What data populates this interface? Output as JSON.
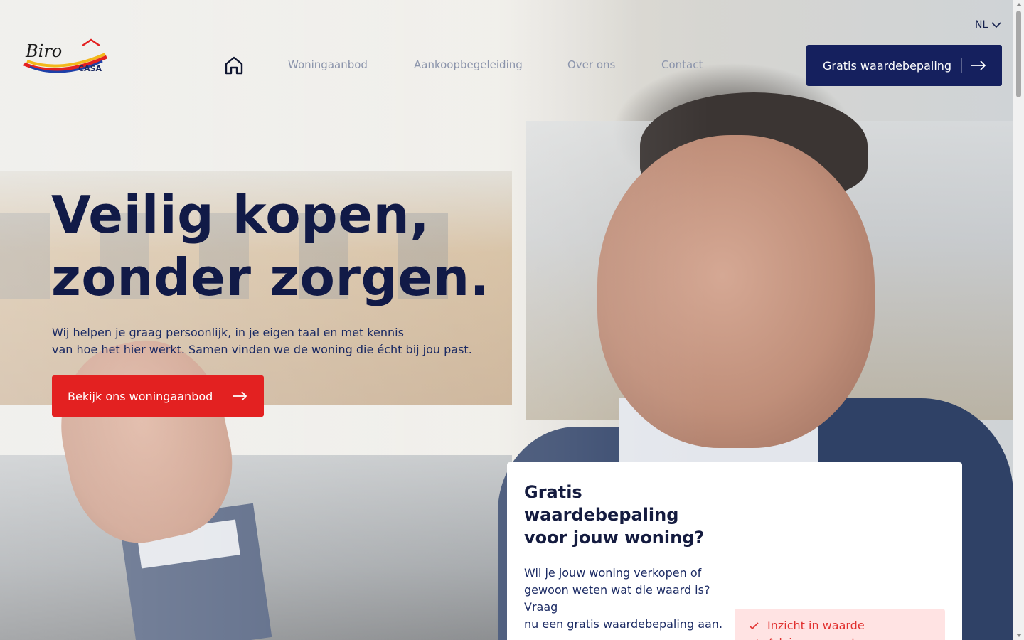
{
  "brand": {
    "logo_word": "Biro",
    "logo_sub": "CASA"
  },
  "header": {
    "language": "NL",
    "nav": [
      {
        "label": "Woningaanbod"
      },
      {
        "label": "Aankoopbegeleiding"
      },
      {
        "label": "Over ons"
      },
      {
        "label": "Contact"
      }
    ],
    "cta_label": "Gratis waardebepaling"
  },
  "hero": {
    "title_line1": "Veilig kopen,",
    "title_line2": "zonder zorgen.",
    "subtitle_line1": "Wij helpen je graag persoonlijk, in je eigen taal en met kennis",
    "subtitle_line2": "van hoe het hier werkt. Samen vinden we de woning die écht bij jou past.",
    "cta_label": "Bekijk ons woningaanbod"
  },
  "card": {
    "title_line1": "Gratis",
    "title_line2": "waardebepaling",
    "title_line3": "voor jouw woning?",
    "text_line1": "Wil je jouw woning verkopen of",
    "text_line2": "gewoon weten wat die waard is?",
    "text_line3": "Vraag",
    "text_line4": "nu een gratis waardebepaling aan.",
    "benefits": [
      "Inzicht in waarde",
      "Advies op maat"
    ]
  },
  "colors": {
    "navy": "#15205e",
    "red": "#e32121",
    "benefit_bg": "#ffe3e3",
    "benefit_text": "#e1302f"
  }
}
